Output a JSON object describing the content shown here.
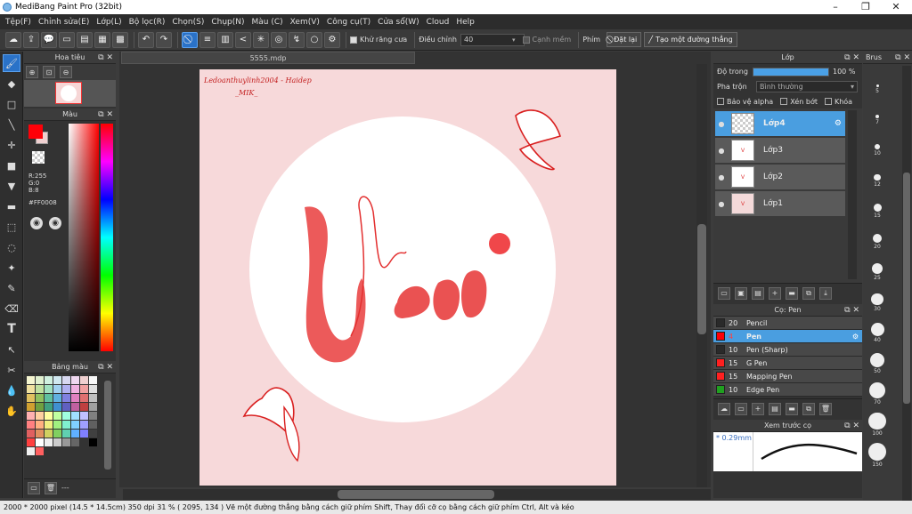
{
  "window": {
    "title": "MediBang Paint Pro (32bit)"
  },
  "menu": [
    "Tệp(F)",
    "Chỉnh sửa(E)",
    "Lớp(L)",
    "Bộ lọc(R)",
    "Chọn(S)",
    "Chụp(N)",
    "Màu (C)",
    "Xem(V)",
    "Công cụ(T)",
    "Cửa sổ(W)",
    "Cloud",
    "Help"
  ],
  "toolbar": {
    "antialias_label": "Khử răng cưa",
    "correction_label": "Điều chỉnh",
    "correction_value": "40",
    "edge_label": "Cạnh mềm",
    "pen_label": "Phím",
    "reset_label": "Đặt lại",
    "line_label": "Tạo một đường thẳng"
  },
  "navigator": {
    "title": "Hoa tiêu"
  },
  "color_panel": {
    "title": "Màu",
    "r": "R:255",
    "g": "G:0",
    "b": "B:8",
    "hex": "#FF0008",
    "primary": "#ff0008"
  },
  "palette": {
    "title": "Bảng màu",
    "footer": "---",
    "colors": [
      "#f5f5d0",
      "#e0f0d0",
      "#d0f0e0",
      "#d0e8f0",
      "#d8d8f0",
      "#f0d8f0",
      "#f0d0d0",
      "#f8f8f8",
      "#f0e0a0",
      "#c0e0a0",
      "#a0e0c0",
      "#a0d0f0",
      "#b0b0f0",
      "#f0b0e0",
      "#f0a0a0",
      "#e0e0e0",
      "#e0c060",
      "#90c060",
      "#60c0a0",
      "#60b0e0",
      "#8080e0",
      "#e080c0",
      "#e07070",
      "#c0c0c0",
      "#d0a030",
      "#70a040",
      "#40a080",
      "#4090d0",
      "#6060c0",
      "#c060a0",
      "#c04040",
      "#a0a0a0",
      "#ffb0b0",
      "#ffd0a0",
      "#ffffa0",
      "#c0ffa0",
      "#a0ffe0",
      "#a0e0ff",
      "#c0c0ff",
      "#808080",
      "#ff8080",
      "#ffb080",
      "#f0f080",
      "#a0f080",
      "#80f0d0",
      "#80d0ff",
      "#a0a0ff",
      "#606060",
      "#e06060",
      "#e09060",
      "#d0d060",
      "#80d060",
      "#60d0b0",
      "#60b0ff",
      "#8080ff",
      "#404040",
      "#ff4040",
      "#ffffff",
      "#eeeeee",
      "#cccccc",
      "#999999",
      "#666666",
      "#333333",
      "#000000",
      "#f0f0f0",
      "#ff6060"
    ]
  },
  "document": {
    "tab": "5555.mdp",
    "watermark_line1": "Ledoanthuylinh2004 - Haidep",
    "watermark_line2": "_MIK_",
    "lettering": "Vui"
  },
  "layers_panel": {
    "title": "Lớp",
    "opacity_label": "Độ trong",
    "opacity_value": "100 %",
    "opacity_fraction": 1.0,
    "blend_label": "Pha trộn",
    "blend_value": "Bình thường",
    "protect_alpha": "Bảo vệ alpha",
    "clip": "Xén bớt",
    "lock": "Khóa",
    "layers": [
      {
        "name": "Lớp4"
      },
      {
        "name": "Lớp3"
      },
      {
        "name": "Lớp2"
      },
      {
        "name": "Lớp1"
      }
    ]
  },
  "brush_panel": {
    "title": "Cọ: Pen",
    "brushes": [
      {
        "size": "20",
        "name": "Pencil",
        "color": "#2a2a2a"
      },
      {
        "size": "4",
        "name": "Pen",
        "color": "#ff0008"
      },
      {
        "size": "10",
        "name": "Pen (Sharp)",
        "color": "#2a2a2a"
      },
      {
        "size": "15",
        "name": "G Pen",
        "color": "#ff2020"
      },
      {
        "size": "15",
        "name": "Mapping Pen",
        "color": "#ff2020"
      },
      {
        "size": "10",
        "name": "Edge Pen",
        "color": "#20a020"
      }
    ]
  },
  "preview_panel": {
    "title": "Xem trước cọ",
    "size": "* 0.29mm"
  },
  "brush_sizes": {
    "title": "Brus",
    "sizes": [
      "5",
      "7",
      "10",
      "12",
      "15",
      "20",
      "25",
      "30",
      "40",
      "50",
      "70",
      "100",
      "150"
    ]
  },
  "status": "2000 * 2000 pixel   (14.5 * 14.5cm)   350 dpi   31 %   ( 2095, 134 )   Vẽ một đường thẳng bằng cách giữ phím Shift, Thay đổi cỡ cọ bằng cách giữ phím Ctrl, Alt và kéo"
}
